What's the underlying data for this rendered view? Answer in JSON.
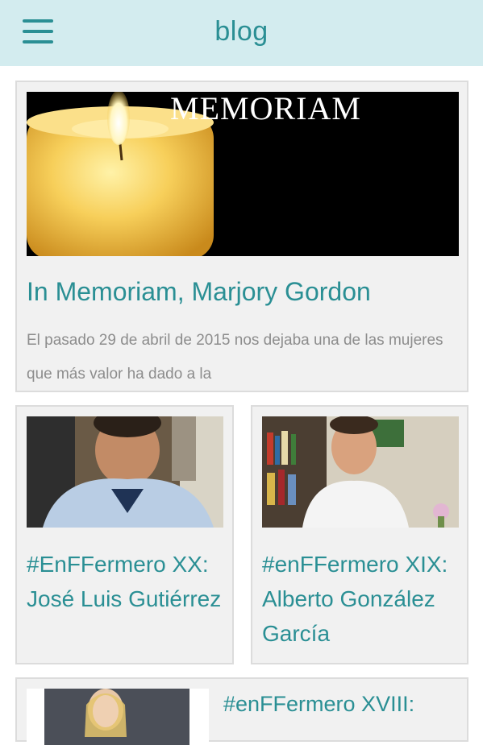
{
  "appbar": {
    "title": "blog",
    "menu_icon": "hamburger-menu-icon"
  },
  "posts": [
    {
      "image_text": "MEMORIAM",
      "title": "In Memoriam, Marjory Gordon",
      "excerpt": "El pasado 29 de abril de 2015 nos dejaba una de las mujeres que más valor ha dado a la"
    },
    {
      "title": "#EnFFermero XX: José Luis Gutiérrez"
    },
    {
      "title": "#enFFermero XIX: Alberto González García"
    },
    {
      "title": "#enFFermero XVIII:"
    }
  ],
  "colors": {
    "accent": "#2a8f94",
    "appbar_bg": "#d3ecef",
    "card_bg": "#f1f1f1",
    "excerpt": "#8d8d8d"
  }
}
